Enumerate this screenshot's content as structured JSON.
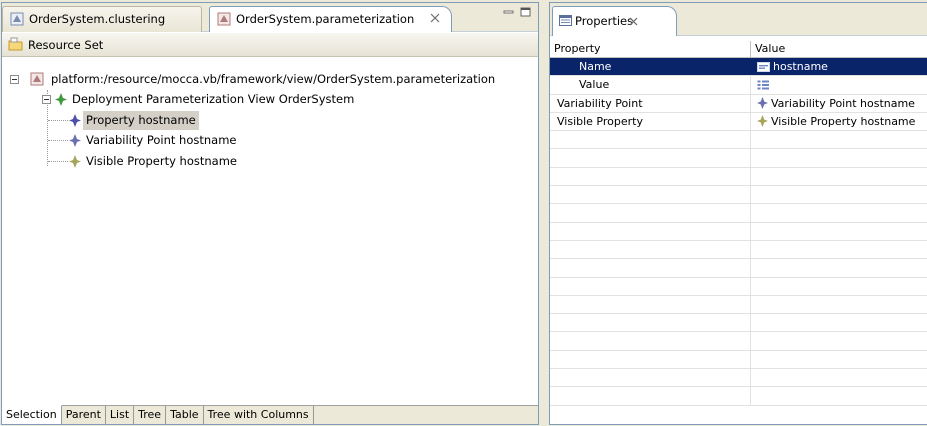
{
  "editor": {
    "tabs": [
      {
        "label": "OrderSystem.clustering",
        "active": false
      },
      {
        "label": "OrderSystem.parameterization",
        "active": true
      }
    ],
    "resource_set_label": "Resource Set",
    "tree": {
      "root": "platform:/resource/mocca.vb/framework/view/OrderSystem.parameterization",
      "view": "Deployment Parameterization View OrderSystem",
      "children": [
        {
          "label": "Property hostname",
          "icon": "property-diamond-icon",
          "selected": true
        },
        {
          "label": "Variability Point hostname",
          "icon": "variability-diamond-icon",
          "selected": false
        },
        {
          "label": "Visible Property hostname",
          "icon": "visible-diamond-icon",
          "selected": false
        }
      ]
    },
    "bottom_tabs": [
      "Selection",
      "Parent",
      "List",
      "Tree",
      "Table",
      "Tree with Columns"
    ],
    "active_bottom_tab": "Selection"
  },
  "properties": {
    "tab_label": "Properties",
    "columns": [
      "Property",
      "Value"
    ],
    "rows": [
      {
        "property": "Name",
        "value": "hostname",
        "selected": true,
        "nested": true,
        "icon": "text-field-icon"
      },
      {
        "property": "Value",
        "value": "",
        "selected": false,
        "nested": true,
        "icon": "list-icon"
      },
      {
        "property": "Variability Point",
        "value": "Variability Point hostname",
        "selected": false,
        "nested": false,
        "icon": "variability-diamond-icon"
      },
      {
        "property": "Visible Property",
        "value": "Visible Property hostname",
        "selected": false,
        "nested": false,
        "icon": "visible-diamond-icon"
      }
    ],
    "empty_rows": 15
  },
  "colors": {
    "selection": "#0a246a",
    "property_diamond": "#4a4fa8",
    "variability_diamond": "#6b6fb2",
    "visible_diamond": "#a8a55a",
    "view_diamond": "#3f9a3f"
  }
}
